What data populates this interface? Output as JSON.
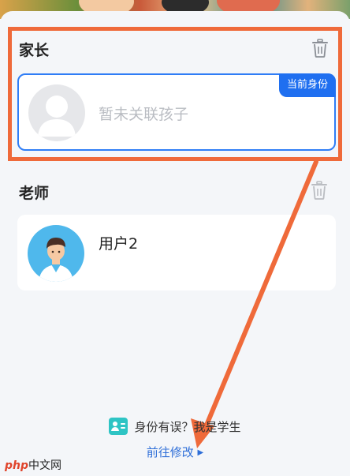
{
  "parent_section": {
    "title": "家长",
    "card": {
      "placeholder_text": "暂未关联孩子",
      "badge": "当前身份"
    }
  },
  "teacher_section": {
    "title": "老师",
    "card": {
      "user_name": "用户2"
    }
  },
  "footer": {
    "hint_text": "身份有误？我是学生",
    "link_text": "前往修改",
    "link_arrow": "▶"
  },
  "watermark": {
    "brand": "php",
    "site": "中文网"
  },
  "colors": {
    "accent": "#2f7df6",
    "annotation": "#ef6a3a",
    "link": "#2f6fd8"
  }
}
